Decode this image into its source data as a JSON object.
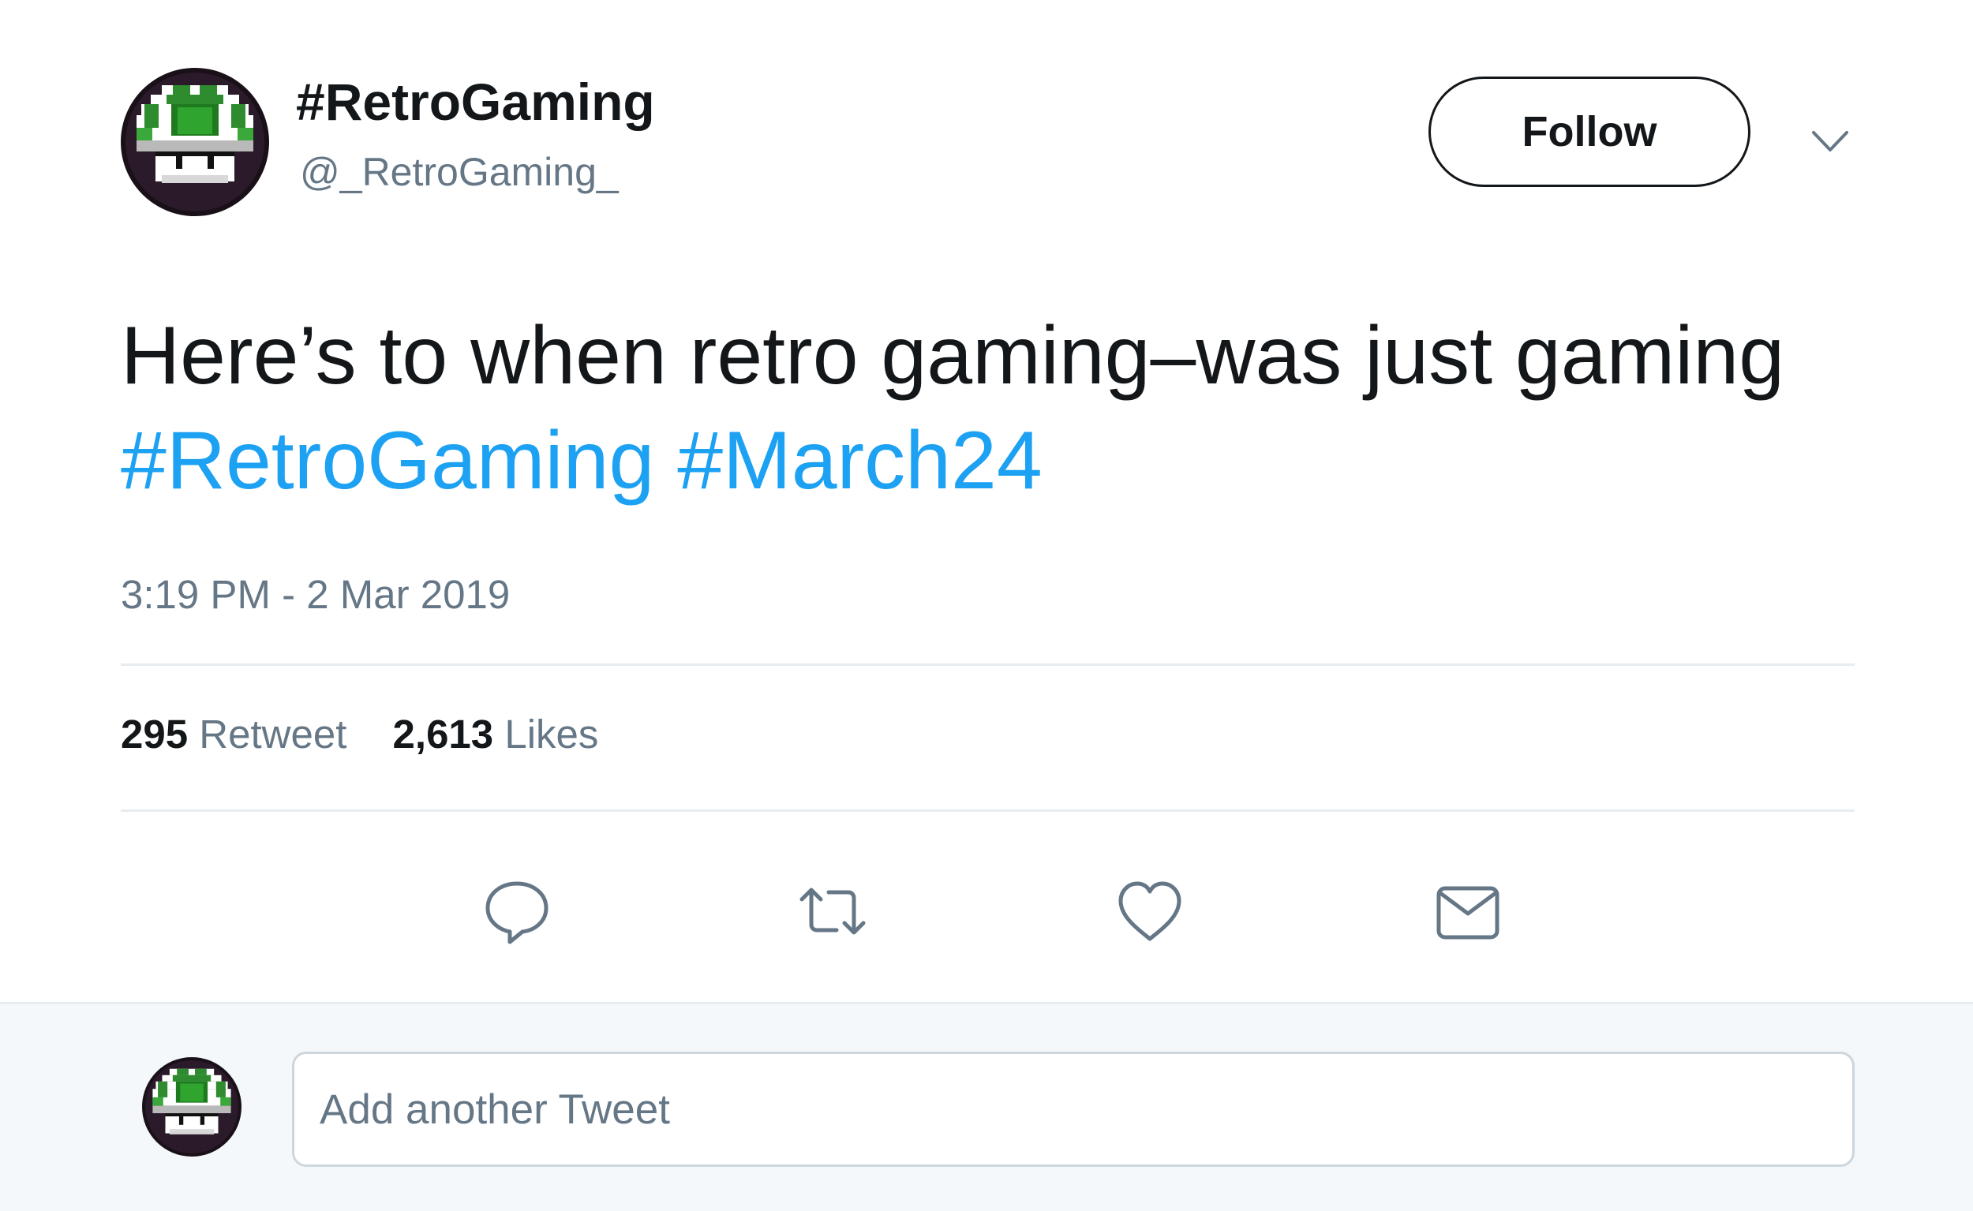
{
  "colors": {
    "text_primary": "#14171a",
    "text_secondary": "#657786",
    "hashtag": "#1da1f2",
    "divider": "#e6ecf0",
    "reply_bg": "#f5f8fa"
  },
  "header": {
    "display_name": "#RetroGaming",
    "handle": "@_RetroGaming_",
    "avatar_icon": "green-mushroom-1up-icon",
    "follow_label": "Follow",
    "menu_icon": "chevron-down-icon"
  },
  "tweet": {
    "text_plain": "Here’s to when retro gaming–was just gaming",
    "hashtags": [
      "#RetroGaming",
      "#March24"
    ],
    "timestamp": "3:19 PM - 2 Mar 2019"
  },
  "stats": {
    "retweets_count": "295",
    "retweets_label": "Retweet",
    "likes_count": "2,613",
    "likes_label": "Likes"
  },
  "actions": {
    "reply_icon": "reply-bubble-icon",
    "retweet_icon": "retweet-icon",
    "like_icon": "heart-icon",
    "dm_icon": "envelope-icon"
  },
  "reply": {
    "placeholder": "Add another Tweet"
  }
}
